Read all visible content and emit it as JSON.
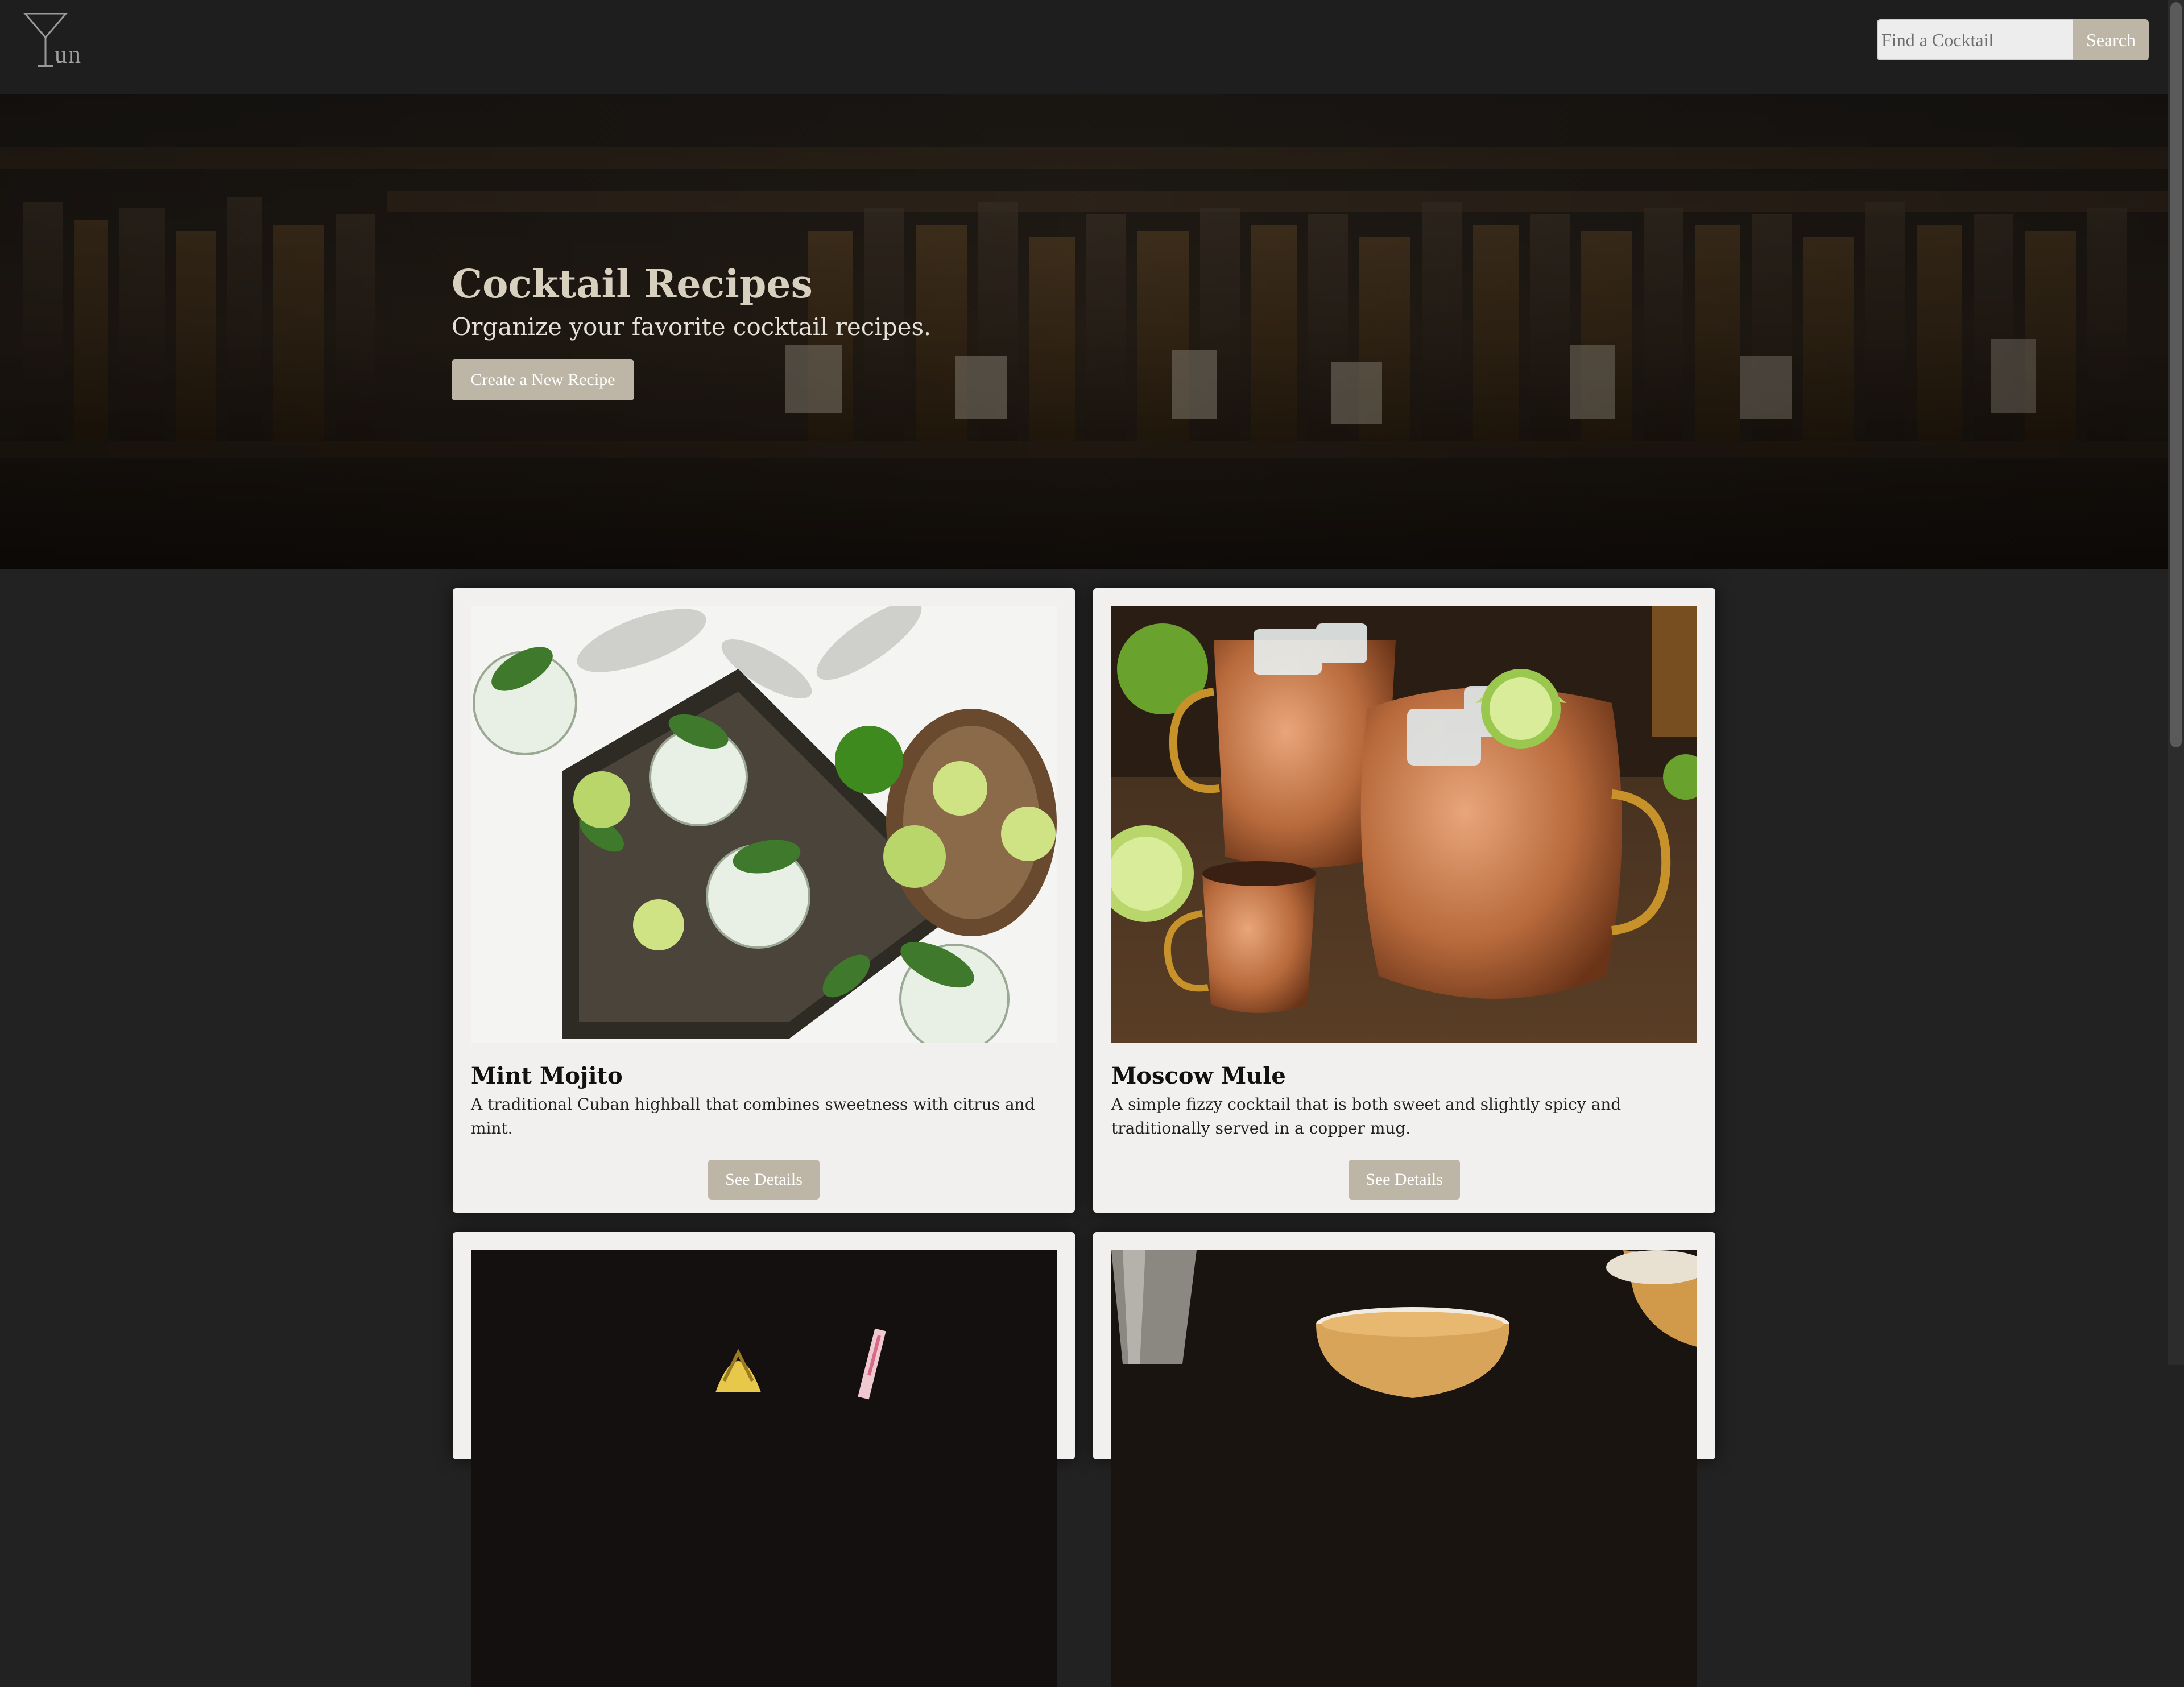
{
  "header": {
    "logo_text": "un",
    "search_placeholder": "Find a Cocktail",
    "search_button": "Search"
  },
  "hero": {
    "title": "Cocktail Recipes",
    "subtitle": "Organize your favorite cocktail recipes.",
    "cta_label": "Create a New Recipe"
  },
  "recipes": [
    {
      "name": "Mint Mojito",
      "description": "A traditional Cuban highball that combines sweetness with citrus and mint.",
      "button": "See Details"
    },
    {
      "name": "Moscow Mule",
      "description": "A simple fizzy cocktail that is both sweet and slightly spicy and traditionally served in a copper mug.",
      "button": "See Details"
    },
    {
      "name": "",
      "description": "",
      "button": ""
    },
    {
      "name": "",
      "description": "",
      "button": ""
    }
  ],
  "colors": {
    "page_bg": "#222222",
    "header_bg": "#1e1e1e",
    "accent": "#bdb6a6",
    "card_bg": "#f1f0ee"
  }
}
